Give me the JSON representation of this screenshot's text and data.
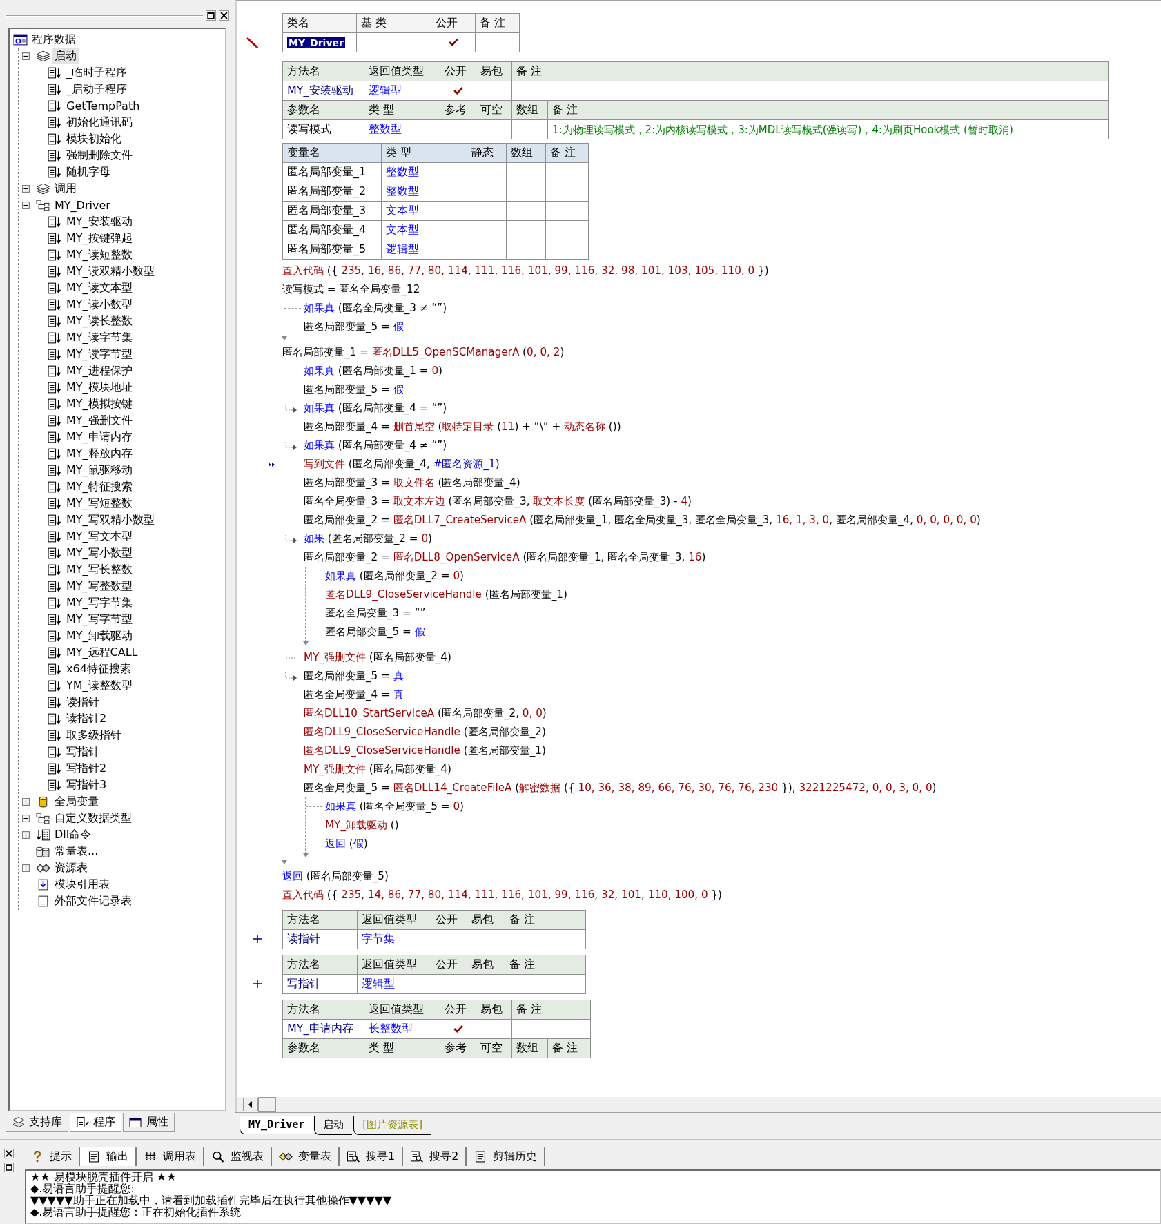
{
  "left_panel": {
    "tree": [
      {
        "label": "程序数据",
        "kind": "program",
        "selected": false,
        "children": [
          {
            "label": "启动",
            "kind": "module",
            "selected": true,
            "expanded": true,
            "children": [
              {
                "label": "_临时子程序",
                "kind": "sub",
                "selected": false
              },
              {
                "label": "_启动子程序",
                "kind": "sub",
                "selected": false
              },
              {
                "label": "GetTempPath",
                "kind": "sub",
                "selected": false
              },
              {
                "label": "初始化通讯码",
                "kind": "sub",
                "selected": false
              },
              {
                "label": "模块初始化",
                "kind": "sub",
                "selected": false
              },
              {
                "label": "强制删除文件",
                "kind": "sub",
                "selected": false
              },
              {
                "label": "随机字母",
                "kind": "sub",
                "selected": false
              }
            ]
          },
          {
            "label": "调用",
            "kind": "module",
            "selected": false,
            "expanded": false
          },
          {
            "label": "MY_Driver",
            "kind": "class",
            "selected": false,
            "expanded": true,
            "children": [
              {
                "label": "MY_安装驱动",
                "kind": "sub",
                "selected": false
              },
              {
                "label": "MY_按键弹起",
                "kind": "sub",
                "selected": false
              },
              {
                "label": "MY_读短整数",
                "kind": "sub",
                "selected": false
              },
              {
                "label": "MY_读双精小数型",
                "kind": "sub",
                "selected": false
              },
              {
                "label": "MY_读文本型",
                "kind": "sub",
                "selected": false
              },
              {
                "label": "MY_读小数型",
                "kind": "sub",
                "selected": false
              },
              {
                "label": "MY_读长整数",
                "kind": "sub",
                "selected": false
              },
              {
                "label": "MY_读字节集",
                "kind": "sub",
                "selected": false
              },
              {
                "label": "MY_读字节型",
                "kind": "sub",
                "selected": false
              },
              {
                "label": "MY_进程保护",
                "kind": "sub",
                "selected": false
              },
              {
                "label": "MY_模块地址",
                "kind": "sub",
                "selected": false
              },
              {
                "label": "MY_模拟按键",
                "kind": "sub",
                "selected": false
              },
              {
                "label": "MY_强删文件",
                "kind": "sub",
                "selected": false
              },
              {
                "label": "MY_申请内存",
                "kind": "sub",
                "selected": false
              },
              {
                "label": "MY_释放内存",
                "kind": "sub",
                "selected": false
              },
              {
                "label": "MY_鼠驱移动",
                "kind": "sub",
                "selected": false
              },
              {
                "label": "MY_特征搜索",
                "kind": "sub",
                "selected": false
              },
              {
                "label": "MY_写短整数",
                "kind": "sub",
                "selected": false
              },
              {
                "label": "MY_写双精小数型",
                "kind": "sub",
                "selected": false
              },
              {
                "label": "MY_写文本型",
                "kind": "sub",
                "selected": false
              },
              {
                "label": "MY_写小数型",
                "kind": "sub",
                "selected": false
              },
              {
                "label": "MY_写长整数",
                "kind": "sub",
                "selected": false
              },
              {
                "label": "MY_写整数型",
                "kind": "sub",
                "selected": false
              },
              {
                "label": "MY_写字节集",
                "kind": "sub",
                "selected": false
              },
              {
                "label": "MY_写字节型",
                "kind": "sub",
                "selected": false
              },
              {
                "label": "MY_卸载驱动",
                "kind": "sub",
                "selected": false
              },
              {
                "label": "MY_远程CALL",
                "kind": "sub",
                "selected": false
              },
              {
                "label": "x64特征搜索",
                "kind": "sub",
                "selected": false
              },
              {
                "label": "YM_读整数型",
                "kind": "sub",
                "selected": false
              },
              {
                "label": "读指针",
                "kind": "sub",
                "selected": false
              },
              {
                "label": "读指针2",
                "kind": "sub",
                "selected": false
              },
              {
                "label": "取多级指针",
                "kind": "sub",
                "selected": false
              },
              {
                "label": "写指针",
                "kind": "sub",
                "selected": false
              },
              {
                "label": "写指针2",
                "kind": "sub",
                "selected": false
              },
              {
                "label": "写指针3",
                "kind": "sub",
                "selected": false
              }
            ]
          },
          {
            "label": "全局变量",
            "kind": "globals",
            "selected": false,
            "expanded": false
          },
          {
            "label": "自定义数据类型",
            "kind": "class",
            "selected": false,
            "expanded": false
          },
          {
            "label": "Dll命令",
            "kind": "dll",
            "selected": false,
            "expanded": false
          },
          {
            "label": "常量表...",
            "kind": "constants",
            "selected": false
          },
          {
            "label": "资源表",
            "kind": "resources",
            "selected": false,
            "expanded": false
          },
          {
            "label": "模块引用表",
            "kind": "modref",
            "selected": false
          },
          {
            "label": "外部文件记录表",
            "kind": "files",
            "selected": false
          }
        ]
      }
    ],
    "tabs": [
      {
        "label": "支持库",
        "kind": "library",
        "selected": false
      },
      {
        "label": "程序",
        "kind": "program",
        "selected": true
      },
      {
        "label": "属性",
        "kind": "properties",
        "selected": false
      }
    ]
  },
  "editor": {
    "class_table": {
      "columns": [
        "类名",
        "基 类",
        "公开",
        "备 注"
      ],
      "rows": [
        {
          "name": "MY_Driver",
          "public": true,
          "selected": true
        }
      ]
    },
    "method": {
      "columns": [
        "方法名",
        "返回值类型",
        "公开",
        "易包",
        "备 注"
      ],
      "name": "MY_安装驱动",
      "return_type": "逻辑型",
      "public": true,
      "param_columns": [
        "参数名",
        "类 型",
        "参考",
        "可空",
        "数组",
        "备 注"
      ],
      "params": [
        {
          "name": "读写模式",
          "type": "整数型",
          "note": "1:为物理读写模式，2:为内核读写模式，3:为MDL读写模式(强读写)，4:为刷页Hook模式 (暂时取消)"
        }
      ]
    },
    "vars": {
      "columns": [
        "变量名",
        "类 型",
        "静态",
        "数组",
        "备 注"
      ],
      "rows": [
        {
          "name": "匿名局部变量_1",
          "type": "整数型"
        },
        {
          "name": "匿名局部变量_2",
          "type": "整数型"
        },
        {
          "name": "匿名局部变量_3",
          "type": "文本型"
        },
        {
          "name": "匿名局部变量_4",
          "type": "文本型"
        },
        {
          "name": "匿名局部变量_5",
          "type": "逻辑型"
        }
      ]
    },
    "code": [
      {
        "tokens": [
          {
            "kind": "cmd",
            "text": "置入代码"
          },
          {
            "kind": "plain",
            "text": " ({ "
          },
          {
            "kind": "number",
            "text": "235, 16, 86, 77, 80, 114, 111, 116, 101, 99, 116, 32, 98, 101, 103, 105, 110, 0"
          },
          {
            "kind": "plain",
            "text": " })"
          }
        ]
      },
      {
        "tokens": [
          {
            "kind": "plain",
            "text": "读写模式 = 匿名全局变量_12"
          }
        ]
      },
      {
        "tokens": [
          {
            "kind": "keyword",
            "text": "如果真"
          },
          {
            "kind": "plain",
            "text": " (匿名全局变量_3 ≠ “”)"
          }
        ],
        "children": [
          {
            "tokens": [
              {
                "kind": "plain",
                "text": "匿名局部变量_5 = "
              },
              {
                "kind": "keyword",
                "text": "假"
              }
            ]
          }
        ]
      },
      {
        "tokens": [
          {
            "kind": "plain",
            "text": "匿名局部变量_1 = "
          },
          {
            "kind": "cmd",
            "text": "匿名DLL5_OpenSCManagerA"
          },
          {
            "kind": "plain",
            "text": " ("
          },
          {
            "kind": "number",
            "text": "0, 0, 2"
          },
          {
            "kind": "plain",
            "text": ")"
          }
        ]
      },
      {
        "tokens": [
          {
            "kind": "keyword",
            "text": "如果真"
          },
          {
            "kind": "plain",
            "text": " (匿名局部变量_1 = "
          },
          {
            "kind": "number",
            "text": "0"
          },
          {
            "kind": "plain",
            "text": ")"
          }
        ],
        "children": [
          {
            "tokens": [
              {
                "kind": "plain",
                "text": "匿名局部变量_5 = "
              },
              {
                "kind": "keyword",
                "text": "假"
              }
            ]
          },
          {
            "arrow": true,
            "tokens": [
              {
                "kind": "keyword",
                "text": "如果真"
              },
              {
                "kind": "plain",
                "text": " (匿名局部变量_4 = “”)"
              }
            ]
          },
          {
            "tokens": [
              {
                "kind": "plain",
                "text": "匿名局部变量_4 = "
              },
              {
                "kind": "cmd",
                "text": "删首尾空"
              },
              {
                "kind": "plain",
                "text": " ("
              },
              {
                "kind": "cmd",
                "text": "取特定目录"
              },
              {
                "kind": "plain",
                "text": " ("
              },
              {
                "kind": "number",
                "text": "11"
              },
              {
                "kind": "plain",
                "text": ") + “\\” + "
              },
              {
                "kind": "cmd",
                "text": "动态名称"
              },
              {
                "kind": "plain",
                "text": " ())"
              }
            ]
          },
          {
            "arrow": true,
            "tokens": [
              {
                "kind": "keyword",
                "text": "如果真"
              },
              {
                "kind": "plain",
                "text": " (匿名局部变量_4 ≠ “”)"
              }
            ]
          },
          {
            "current": true,
            "tokens": [
              {
                "kind": "cmd",
                "text": "写到文件"
              },
              {
                "kind": "plain",
                "text": " (匿名局部变量_4, "
              },
              {
                "kind": "resource",
                "text": "#匿名资源_1"
              },
              {
                "kind": "plain",
                "text": ")"
              }
            ]
          },
          {
            "tokens": [
              {
                "kind": "plain",
                "text": "匿名局部变量_3 = "
              },
              {
                "kind": "cmd",
                "text": "取文件名"
              },
              {
                "kind": "plain",
                "text": " (匿名局部变量_4)"
              }
            ]
          },
          {
            "tokens": [
              {
                "kind": "plain",
                "text": "匿名全局变量_3 = "
              },
              {
                "kind": "cmd",
                "text": "取文本左边"
              },
              {
                "kind": "plain",
                "text": " (匿名局部变量_3, "
              },
              {
                "kind": "cmd",
                "text": "取文本长度"
              },
              {
                "kind": "plain",
                "text": " (匿名局部变量_3) - "
              },
              {
                "kind": "number",
                "text": "4"
              },
              {
                "kind": "plain",
                "text": ")"
              }
            ]
          },
          {
            "tokens": [
              {
                "kind": "plain",
                "text": "匿名局部变量_2 = "
              },
              {
                "kind": "cmd",
                "text": "匿名DLL7_CreateServiceA"
              },
              {
                "kind": "plain",
                "text": " (匿名局部变量_1, 匿名全局变量_3, 匿名全局变量_3, "
              },
              {
                "kind": "number",
                "text": "16, 1, 3, 0"
              },
              {
                "kind": "plain",
                "text": ", 匿名局部变量_4, "
              },
              {
                "kind": "number",
                "text": "0, 0, 0, 0, 0"
              },
              {
                "kind": "plain",
                "text": ")"
              }
            ]
          },
          {
            "arrow": true,
            "tokens": [
              {
                "kind": "keyword",
                "text": "如果"
              },
              {
                "kind": "plain",
                "text": " (匿名局部变量_2 = "
              },
              {
                "kind": "number",
                "text": "0"
              },
              {
                "kind": "plain",
                "text": ")"
              }
            ]
          },
          {
            "tokens": [
              {
                "kind": "plain",
                "text": "匿名局部变量_2 = "
              },
              {
                "kind": "cmd",
                "text": "匿名DLL8_OpenServiceA"
              },
              {
                "kind": "plain",
                "text": " (匿名局部变量_1, 匿名全局变量_3, "
              },
              {
                "kind": "number",
                "text": "16"
              },
              {
                "kind": "plain",
                "text": ")"
              }
            ]
          },
          {
            "tokens": [
              {
                "kind": "keyword",
                "text": "如果真"
              },
              {
                "kind": "plain",
                "text": " (匿名局部变量_2 = "
              },
              {
                "kind": "number",
                "text": "0"
              },
              {
                "kind": "plain",
                "text": ")"
              }
            ],
            "children": [
              {
                "tokens": [
                  {
                    "kind": "cmd",
                    "text": "匿名DLL9_CloseServiceHandle"
                  },
                  {
                    "kind": "plain",
                    "text": " (匿名局部变量_1)"
                  }
                ]
              },
              {
                "tokens": [
                  {
                    "kind": "plain",
                    "text": "匿名全局变量_3 = “”"
                  }
                ]
              },
              {
                "tokens": [
                  {
                    "kind": "plain",
                    "text": "匿名局部变量_5 = "
                  },
                  {
                    "kind": "keyword",
                    "text": "假"
                  }
                ]
              }
            ]
          },
          {
            "dashed": true,
            "tokens": [
              {
                "kind": "cmd",
                "text": "MY_强删文件"
              },
              {
                "kind": "plain",
                "text": " (匿名局部变量_4)"
              }
            ]
          },
          {
            "arrow": true,
            "tokens": [
              {
                "kind": "plain",
                "text": "匿名局部变量_5 = "
              },
              {
                "kind": "keyword",
                "text": "真"
              }
            ]
          },
          {
            "tokens": [
              {
                "kind": "plain",
                "text": "匿名全局变量_4 = "
              },
              {
                "kind": "keyword",
                "text": "真"
              }
            ]
          },
          {
            "tokens": [
              {
                "kind": "cmd",
                "text": "匿名DLL10_StartServiceA"
              },
              {
                "kind": "plain",
                "text": " (匿名局部变量_2, "
              },
              {
                "kind": "number",
                "text": "0, 0"
              },
              {
                "kind": "plain",
                "text": ")"
              }
            ]
          },
          {
            "tokens": [
              {
                "kind": "cmd",
                "text": "匿名DLL9_CloseServiceHandle"
              },
              {
                "kind": "plain",
                "text": " (匿名局部变量_2)"
              }
            ]
          },
          {
            "tokens": [
              {
                "kind": "cmd",
                "text": "匿名DLL9_CloseServiceHandle"
              },
              {
                "kind": "plain",
                "text": " (匿名局部变量_1)"
              }
            ]
          },
          {
            "tokens": [
              {
                "kind": "cmd",
                "text": "MY_强删文件"
              },
              {
                "kind": "plain",
                "text": " (匿名局部变量_4)"
              }
            ]
          },
          {
            "tokens": [
              {
                "kind": "plain",
                "text": "匿名全局变量_5 = "
              },
              {
                "kind": "cmd",
                "text": "匿名DLL14_CreateFileA"
              },
              {
                "kind": "plain",
                "text": " ("
              },
              {
                "kind": "cmd",
                "text": "解密数据"
              },
              {
                "kind": "plain",
                "text": " ({ "
              },
              {
                "kind": "number",
                "text": "10, 36, 38, 89, 66, 76, 30, 76, 76, 230"
              },
              {
                "kind": "plain",
                "text": " }), "
              },
              {
                "kind": "number",
                "text": "3221225472, 0, 0, 3, 0, 0"
              },
              {
                "kind": "plain",
                "text": ")"
              }
            ]
          },
          {
            "tokens": [
              {
                "kind": "keyword",
                "text": "如果真"
              },
              {
                "kind": "plain",
                "text": " (匿名全局变量_5 = "
              },
              {
                "kind": "number",
                "text": "0"
              },
              {
                "kind": "plain",
                "text": ")"
              }
            ],
            "children": [
              {
                "tokens": [
                  {
                    "kind": "cmd",
                    "text": "MY_卸载驱动"
                  },
                  {
                    "kind": "plain",
                    "text": " ()"
                  }
                ]
              },
              {
                "tokens": [
                  {
                    "kind": "keyword",
                    "text": "返回"
                  },
                  {
                    "kind": "plain",
                    "text": " ("
                  },
                  {
                    "kind": "keyword",
                    "text": "假"
                  },
                  {
                    "kind": "plain",
                    "text": ")"
                  }
                ]
              }
            ]
          }
        ]
      },
      {
        "tokens": [
          {
            "kind": "keyword",
            "text": "返回"
          },
          {
            "kind": "plain",
            "text": " (匿名局部变量_5)"
          }
        ]
      },
      {
        "tokens": [
          {
            "kind": "cmd",
            "text": "置入代码"
          },
          {
            "kind": "plain",
            "text": " ({ "
          },
          {
            "kind": "number",
            "text": "235, 14, 86, 77, 80, 114, 111, 116, 101, 99, 116, 32, 101, 110, 100, 0"
          },
          {
            "kind": "plain",
            "text": " })"
          }
        ]
      }
    ],
    "more_methods": [
      {
        "columns": [
          "方法名",
          "返回值类型",
          "公开",
          "易包",
          "备 注"
        ],
        "name": "读指针",
        "return_type": "字节集",
        "public": false,
        "expanded": false
      },
      {
        "columns": [
          "方法名",
          "返回值类型",
          "公开",
          "易包",
          "备 注"
        ],
        "name": "写指针",
        "return_type": "逻辑型",
        "public": false,
        "expanded": false
      },
      {
        "columns": [
          "方法名",
          "返回值类型",
          "公开",
          "易包",
          "备 注"
        ],
        "name": "MY_申请内存",
        "return_type": "长整数型",
        "public": true,
        "expanded": true,
        "param_columns": [
          "参数名",
          "类 型",
          "参考",
          "可空",
          "数组",
          "备 注"
        ]
      }
    ],
    "file_tabs": [
      {
        "label": "MY_Driver",
        "kind": "class",
        "selected": true
      },
      {
        "label": "启动",
        "kind": "module",
        "selected": false
      },
      {
        "label": "[图片资源表]",
        "kind": "resource",
        "selected": false
      }
    ]
  },
  "bottom_panel": {
    "tabs": [
      {
        "label": "提示",
        "kind": "hint",
        "selected": false
      },
      {
        "label": "输出",
        "kind": "output",
        "selected": true
      },
      {
        "label": "调用表",
        "kind": "calls",
        "selected": false
      },
      {
        "label": "监视表",
        "kind": "watch",
        "selected": false
      },
      {
        "label": "变量表",
        "kind": "vars",
        "selected": false
      },
      {
        "label": "搜寻1",
        "kind": "find",
        "selected": false
      },
      {
        "label": "搜寻2",
        "kind": "find",
        "selected": false
      },
      {
        "label": "剪辑历史",
        "kind": "clips",
        "selected": false
      }
    ],
    "output_lines": [
      "★★ 易模块脱壳插件开启 ★★",
      "◆.易语言助手提醒您:",
      "▼▼▼▼▼助手正在加载中，请看到加载插件完毕后在执行其他操作▼▼▼▼▼",
      "◆.易语言助手提醒您：正在初始化插件系统"
    ]
  }
}
